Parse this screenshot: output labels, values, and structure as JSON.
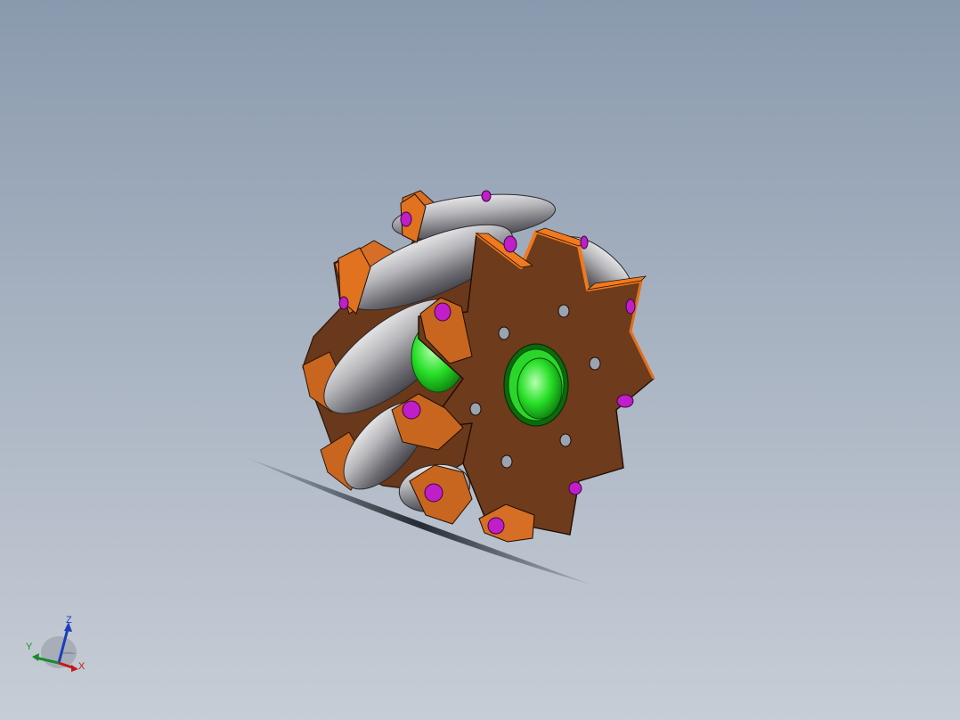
{
  "viewport": {
    "background_top": "#8a9aae",
    "background_bottom": "#c7cdd6"
  },
  "model": {
    "name": "mecanum-wheel",
    "hub_color": "#6e3b1c",
    "hub_edge_color": "#f07a1e",
    "roller_color": "#a9a9ad",
    "axle_color": "#1fd51f",
    "bolt_color": "#c01ec8"
  },
  "triad": {
    "x_label": "X",
    "y_label": "Y",
    "z_label": "Z",
    "x_color": "#c41818",
    "y_color": "#1a8a2a",
    "z_color": "#1a3fb8"
  }
}
